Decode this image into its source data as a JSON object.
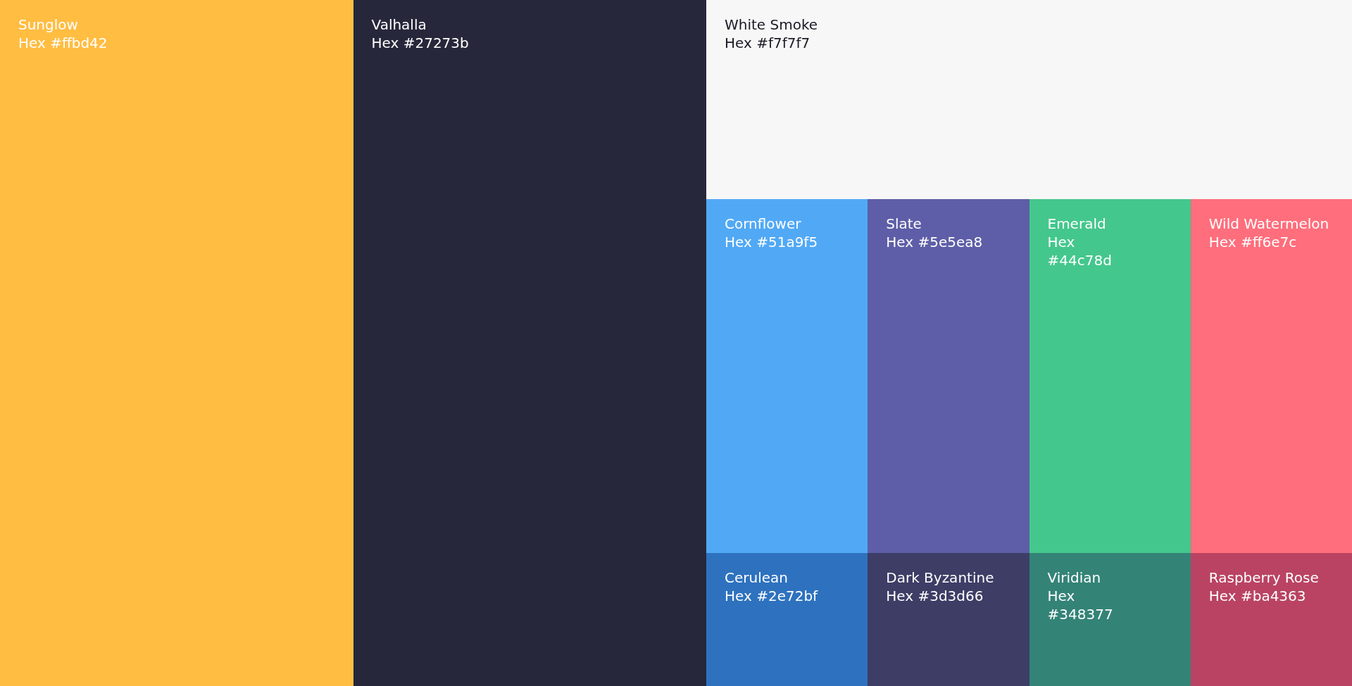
{
  "primary": [
    {
      "name": "Sunglow",
      "hex": "Hex #ffbd42",
      "color": "#ffbd42"
    },
    {
      "name": "Valhalla",
      "hex": "Hex #27273b",
      "color": "#27273b"
    }
  ],
  "top": {
    "name": "White Smoke",
    "hex": "Hex #f7f7f7",
    "color": "#f7f7f7"
  },
  "grid_rows": [
    {
      "swatches": [
        {
          "name": "Cornflower",
          "hex": "Hex #51a9f5",
          "color": "#51a9f5",
          "stacked": false
        },
        {
          "name": "Slate",
          "hex": "Hex #5e5ea8",
          "color": "#5e5ea8",
          "stacked": false
        },
        {
          "name": "Emerald",
          "hex": "Hex #44c78d",
          "color": "#44c78d",
          "stacked": true
        },
        {
          "name": "Wild Watermelon",
          "hex": "Hex #ff6e7c",
          "color": "#ff6e7c",
          "stacked": false
        }
      ]
    },
    {
      "swatches": [
        {
          "name": "Cerulean",
          "hex": "Hex #2e72bf",
          "color": "#2e72bf",
          "stacked": false
        },
        {
          "name": "Dark Byzantine",
          "hex": "Hex #3d3d66",
          "color": "#3d3d66",
          "stacked": false
        },
        {
          "name": "Viridian",
          "hex": "Hex #348377",
          "color": "#348377",
          "stacked": true
        },
        {
          "name": "Raspberry Rose",
          "hex": "Hex #ba4363",
          "color": "#ba4363",
          "stacked": false
        }
      ]
    }
  ]
}
